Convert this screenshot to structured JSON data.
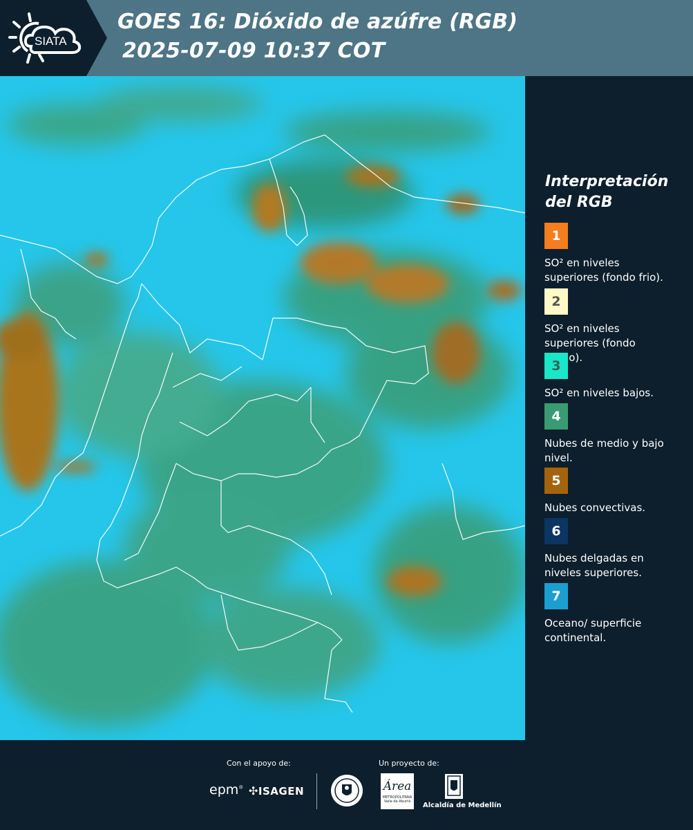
{
  "header": {
    "logo_text": "SIATA",
    "title_line1": "GOES 16: Dióxido de azúfre (RGB)",
    "title_line2": "2025-07-09 10:37 COT"
  },
  "legend": {
    "title": "Interpretación del RGB",
    "items": [
      {
        "number": "1",
        "color": "#f47d1f",
        "number_color": "#ffffff",
        "text": "SO² en niveles superiores (fondo frio)."
      },
      {
        "number": "2",
        "color": "#fff9c6",
        "number_color": "#555555",
        "text": "SO² en niveles superiores (fondo calido)."
      },
      {
        "number": "3",
        "color": "#19e7c8",
        "number_color": "#336655",
        "text": "SO² en niveles bajos."
      },
      {
        "number": "4",
        "color": "#3a9b73",
        "number_color": "#ffffff",
        "text": "Nubes de medio y bajo nivel."
      },
      {
        "number": "5",
        "color": "#a4640e",
        "number_color": "#ffffff",
        "text": "Nubes convectivas."
      },
      {
        "number": "6",
        "color": "#0b3563",
        "number_color": "#ffffff",
        "text": "Nubes delgadas en niveles superiores."
      },
      {
        "number": "7",
        "color": "#1b9fd1",
        "number_color": "#ffffff",
        "text": "Oceano/ superficie continental."
      }
    ]
  },
  "footer": {
    "support_label": "Con el apoyo de:",
    "project_label": "Un proyecto de:",
    "epm_text": "epm",
    "isagen_text": "ISAGEN",
    "area_text": "Área",
    "area_sub": "METROPOLITANA",
    "area_sub2": "Valle de Aburrá",
    "alcaldia_text": "Alcaldía de Medellín"
  }
}
